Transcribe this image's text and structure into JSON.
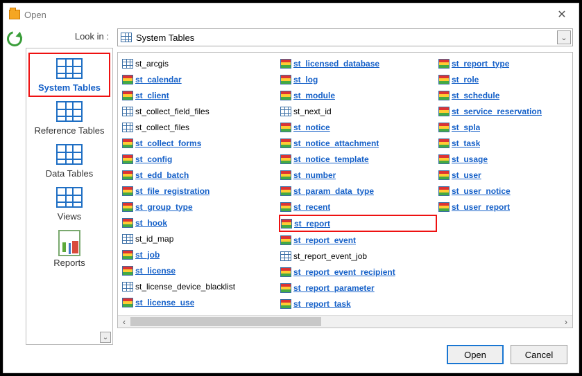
{
  "window": {
    "title": "Open"
  },
  "lookin": {
    "label": "Look in :",
    "value": "System Tables"
  },
  "sidebar": {
    "items": [
      {
        "label": "System Tables",
        "icon": "grid",
        "selected": true
      },
      {
        "label": "Reference Tables",
        "icon": "grid",
        "selected": false
      },
      {
        "label": "Data Tables",
        "icon": "grid",
        "selected": false
      },
      {
        "label": "Views",
        "icon": "grid",
        "selected": false
      },
      {
        "label": "Reports",
        "icon": "report",
        "selected": false
      }
    ]
  },
  "files": [
    {
      "name": "st_arcgis",
      "icon": "plain",
      "link": false
    },
    {
      "name": "st_calendar",
      "icon": "color",
      "link": true
    },
    {
      "name": "st_client",
      "icon": "color",
      "link": true
    },
    {
      "name": "st_collect_field_files",
      "icon": "plain",
      "link": false
    },
    {
      "name": "st_collect_files",
      "icon": "plain",
      "link": false
    },
    {
      "name": "st_collect_forms",
      "icon": "color",
      "link": true
    },
    {
      "name": "st_config",
      "icon": "color",
      "link": true
    },
    {
      "name": "st_edd_batch",
      "icon": "color",
      "link": true
    },
    {
      "name": "st_file_registration",
      "icon": "color",
      "link": true
    },
    {
      "name": "st_group_type",
      "icon": "color",
      "link": true
    },
    {
      "name": "st_hook",
      "icon": "color",
      "link": true
    },
    {
      "name": "st_id_map",
      "icon": "plain",
      "link": false
    },
    {
      "name": "st_job",
      "icon": "color",
      "link": true
    },
    {
      "name": "st_license",
      "icon": "color",
      "link": true
    },
    {
      "name": "st_license_device_blacklist",
      "icon": "plain",
      "link": false
    },
    {
      "name": "st_license_use",
      "icon": "color",
      "link": true
    },
    {
      "name": "st_licensed_database",
      "icon": "color",
      "link": true
    },
    {
      "name": "st_log",
      "icon": "color",
      "link": true
    },
    {
      "name": "st_module",
      "icon": "color",
      "link": true
    },
    {
      "name": "st_next_id",
      "icon": "plain",
      "link": false
    },
    {
      "name": "st_notice",
      "icon": "color",
      "link": true
    },
    {
      "name": "st_notice_attachment",
      "icon": "color",
      "link": true
    },
    {
      "name": "st_notice_template",
      "icon": "color",
      "link": true
    },
    {
      "name": "st_number",
      "icon": "color",
      "link": true
    },
    {
      "name": "st_param_data_type",
      "icon": "color",
      "link": true
    },
    {
      "name": "st_recent",
      "icon": "color",
      "link": true
    },
    {
      "name": "st_report",
      "icon": "color",
      "link": true,
      "highlight": true
    },
    {
      "name": "st_report_event",
      "icon": "color",
      "link": true
    },
    {
      "name": "st_report_event_job",
      "icon": "plain",
      "link": false
    },
    {
      "name": "st_report_event_recipient",
      "icon": "color",
      "link": true
    },
    {
      "name": "st_report_parameter",
      "icon": "color",
      "link": true
    },
    {
      "name": "st_report_task",
      "icon": "color",
      "link": true
    },
    {
      "name": "st_report_type",
      "icon": "color",
      "link": true
    },
    {
      "name": "st_role",
      "icon": "color",
      "link": true
    },
    {
      "name": "st_schedule",
      "icon": "color",
      "link": true
    },
    {
      "name": "st_service_reservation",
      "icon": "color",
      "link": true
    },
    {
      "name": "st_spla",
      "icon": "color",
      "link": true
    },
    {
      "name": "st_task",
      "icon": "color",
      "link": true
    },
    {
      "name": "st_usage",
      "icon": "color",
      "link": true
    },
    {
      "name": "st_user",
      "icon": "color",
      "link": true
    },
    {
      "name": "st_user_notice",
      "icon": "color",
      "link": true
    },
    {
      "name": "st_user_report",
      "icon": "color",
      "link": true
    }
  ],
  "buttons": {
    "open": "Open",
    "cancel": "Cancel"
  }
}
